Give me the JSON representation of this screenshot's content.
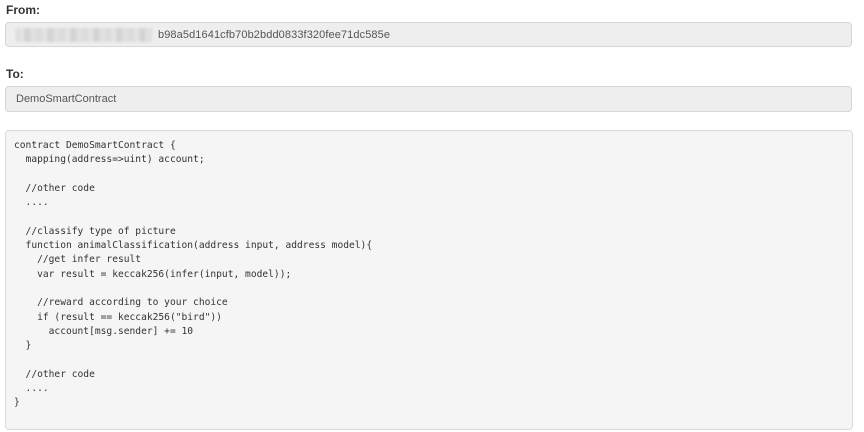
{
  "from": {
    "label": "From:",
    "address_suffix": "b98a5d1641cfb70b2bdd0833f320fee71dc585e"
  },
  "to": {
    "label": "To:",
    "value": "DemoSmartContract"
  },
  "code": {
    "lines": [
      "contract DemoSmartContract {",
      "  mapping(address=>uint) account;",
      "",
      "  //other code",
      "  ....",
      "",
      "  //classify type of picture",
      "  function animalClassification(address input, address model){",
      "    //get infer result",
      "    var result = keccak256(infer(input, model));",
      "",
      "    //reward according to your choice",
      "    if (result == keccak256(\"bird\"))",
      "      account[msg.sender] += 10",
      "  }",
      "",
      "  //other code",
      "  ....",
      "}"
    ]
  }
}
